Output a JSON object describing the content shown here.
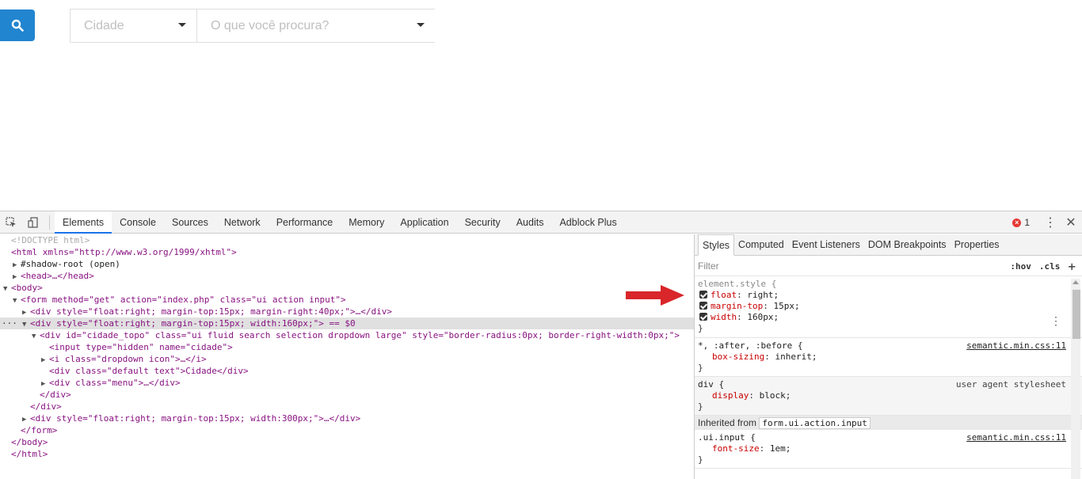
{
  "page": {
    "city_placeholder": "Cidade",
    "search_placeholder": "O que você procura?"
  },
  "devtools": {
    "tabs": [
      "Elements",
      "Console",
      "Sources",
      "Network",
      "Performance",
      "Memory",
      "Application",
      "Security",
      "Audits",
      "Adblock Plus"
    ],
    "error_count": "1",
    "styles_tabs": [
      "Styles",
      "Computed",
      "Event Listeners",
      "DOM Breakpoints",
      "Properties"
    ],
    "filter_placeholder": "Filter",
    "hov": ":hov",
    "cls": ".cls",
    "plus": "+"
  },
  "dom": [
    {
      "t": "<!DOCTYPE html>"
    },
    {
      "t": "<html xmlns=\"http://www.w3.org/1999/xhtml\">"
    },
    {
      "t": "#shadow-root (open)"
    },
    {
      "t": "<head>…</head>"
    },
    {
      "t": "<body>"
    },
    {
      "t": "<form method=\"get\" action=\"index.php\" class=\"ui action input\">"
    },
    {
      "t": "<div style=\"float:right; margin-top:15px; margin-right:40px;\">…</div>"
    },
    {
      "t": "<div style=\"float:right; margin-top:15px; width:160px;\"> == $0"
    },
    {
      "t": "<div id=\"cidade_topo\" class=\"ui fluid search selection dropdown large\" style=\"border-radius:0px; border-right-width:0px;\">"
    },
    {
      "t": "<input type=\"hidden\" name=\"cidade\">"
    },
    {
      "t": "<i class=\"dropdown icon\">…</i>"
    },
    {
      "t": "<div class=\"default text\">Cidade</div>"
    },
    {
      "t": "<div class=\"menu\">…</div>"
    },
    {
      "t": "</div>"
    },
    {
      "t": "</div>"
    },
    {
      "t": "<div style=\"float:right; margin-top:15px; width:300px;\">…</div>"
    },
    {
      "t": "</form>"
    },
    {
      "t": "</body>"
    },
    {
      "t": "</html>"
    }
  ],
  "styles": {
    "element_style_selector": "element.style {",
    "element_props": [
      {
        "prop": "float",
        "val": "right;"
      },
      {
        "prop": "margin-top",
        "val": "15px;"
      },
      {
        "prop": "width",
        "val": "160px;"
      }
    ],
    "rule2_selector": "*, :after, :before {",
    "rule2_source": "semantic.min.css:11",
    "rule2_prop": "box-sizing",
    "rule2_val": "inherit;",
    "rule3_selector": "div {",
    "rule3_source": "user agent stylesheet",
    "rule3_prop": "display",
    "rule3_val": "block;",
    "inherited_label": "Inherited from",
    "inherited_from": "form.ui.action.input",
    "rule4_selector": ".ui.input {",
    "rule4_source": "semantic.min.css:11",
    "rule4_prop": "font-size",
    "rule4_val": "1em;",
    "close_brace": "}"
  }
}
